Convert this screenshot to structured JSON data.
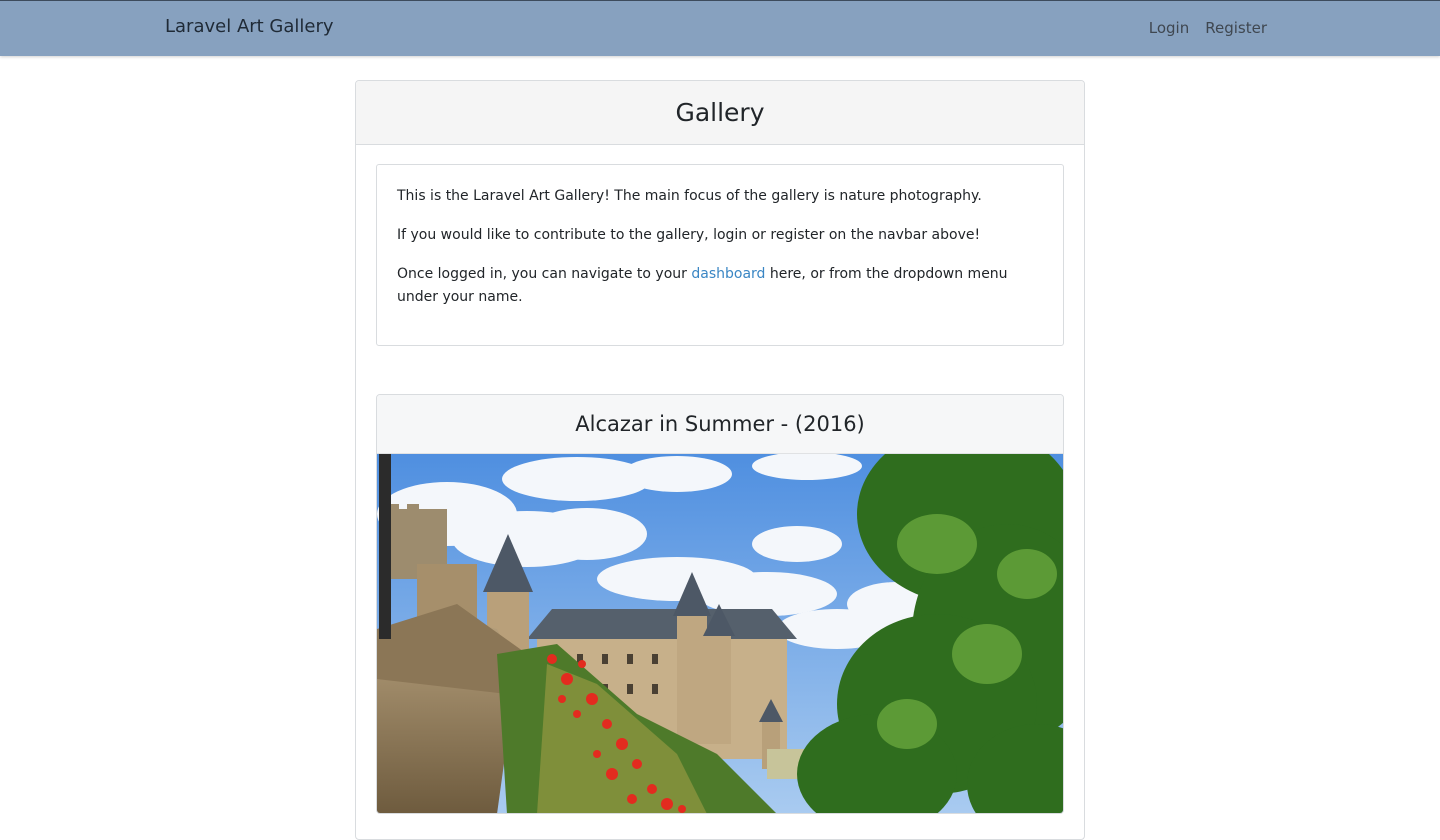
{
  "navbar": {
    "brand": "Laravel Art Gallery",
    "links": [
      {
        "label": "Login"
      },
      {
        "label": "Register"
      }
    ],
    "bg_color": "#87a1bf"
  },
  "main": {
    "title": "Gallery",
    "intro": {
      "p1": "This is the Laravel Art Gallery! The main focus of the gallery is nature photography.",
      "p2": "If you would like to contribute to the gallery, login or register on the navbar above!",
      "p3_before": "Once logged in, you can navigate to your ",
      "p3_link": "dashboard",
      "p3_after": " here, or from the dropdown menu under your name."
    },
    "artworks": [
      {
        "title": "Alcazar in Summer - (2016)"
      }
    ]
  },
  "colors": {
    "link": "#3a86c4"
  }
}
